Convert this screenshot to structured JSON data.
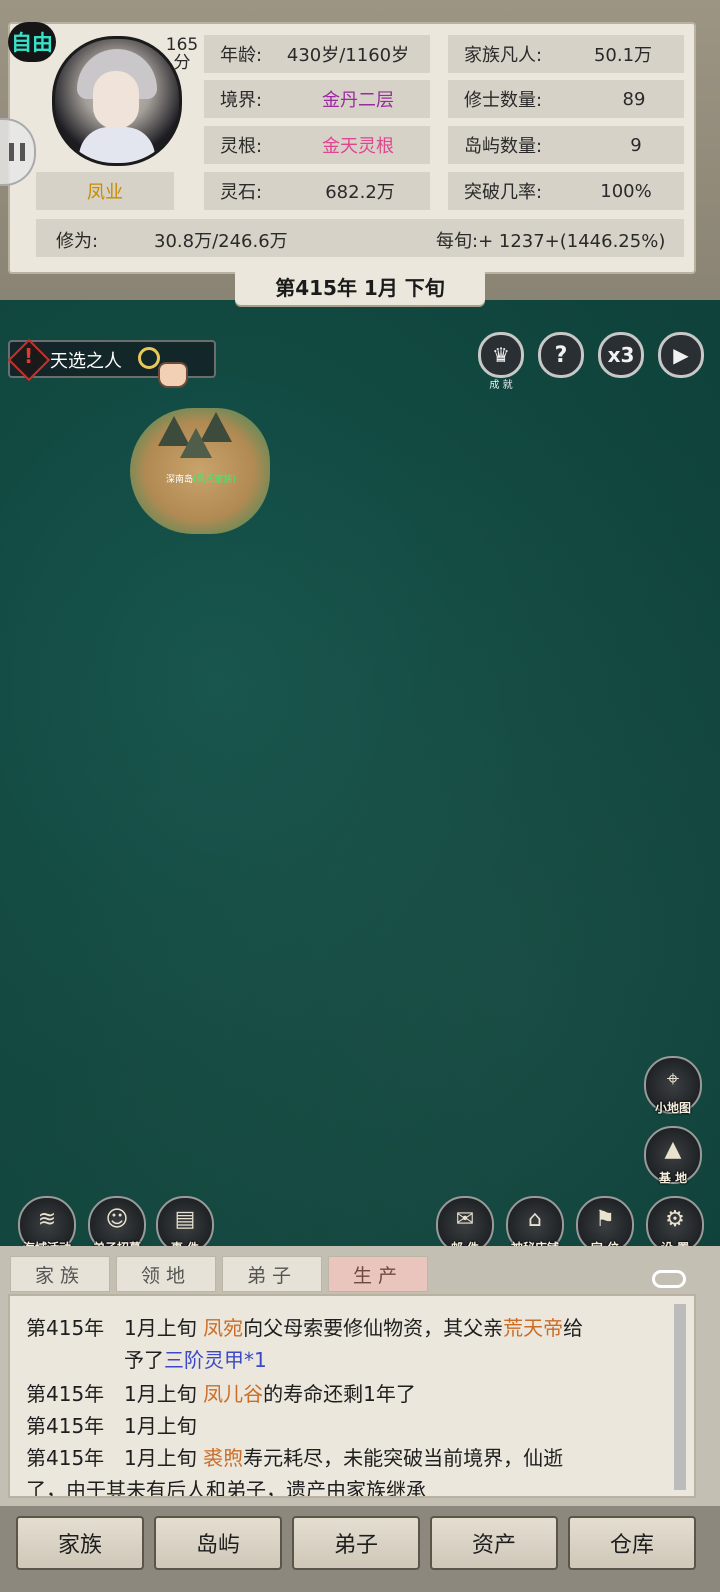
{
  "header": {
    "mode_badge": "自由",
    "score_value": "165",
    "score_unit": "分",
    "character_name": "凤业",
    "stats_left": [
      {
        "label": "年龄:",
        "value": "430岁/1160岁",
        "color": "#2a2a2a"
      },
      {
        "label": "境界:",
        "value": "金丹二层",
        "color": "#9a2aa0"
      },
      {
        "label": "灵根:",
        "value": "金天灵根",
        "color": "#e0458f"
      },
      {
        "label": "灵石:",
        "value": "682.2万",
        "color": "#2a2a2a"
      }
    ],
    "stats_right": [
      {
        "label": "家族凡人:",
        "value": "50.1万"
      },
      {
        "label": "修士数量:",
        "value": "89"
      },
      {
        "label": "岛屿数量:",
        "value": "9"
      },
      {
        "label": "突破几率:",
        "value": "100%"
      }
    ],
    "cultivation_label": "修为:",
    "cultivation_value": "30.8万/246.6万",
    "per_period": "每旬:+ 1237+(1446.25%)"
  },
  "date_banner": "第415年 1月 下旬",
  "event_tag": "天选之人",
  "top_buttons": {
    "achievements_caption": "成 就",
    "help_glyph": "?",
    "speed_label": "x3",
    "play_glyph": "▶"
  },
  "map": {
    "island_name": "深南岛",
    "island_owner": "(凤氏家族)"
  },
  "right_icons": [
    {
      "caption": "小地图",
      "glyph": "⌖"
    },
    {
      "caption": "基 地",
      "glyph": "▲"
    }
  ],
  "bottom_left_icons": [
    {
      "caption": "海域活动",
      "glyph": "≋"
    },
    {
      "caption": "弟子招募",
      "glyph": "☺"
    },
    {
      "caption": "事 件",
      "glyph": "▤"
    }
  ],
  "bottom_right_icons": [
    {
      "caption": "邮 件",
      "glyph": "✉"
    },
    {
      "caption": "神秘店铺",
      "glyph": "⌂"
    },
    {
      "caption": "定 位",
      "glyph": "⚑"
    },
    {
      "caption": "设 置",
      "glyph": "⚙"
    }
  ],
  "log_tabs": [
    "家族",
    "领地",
    "弟子",
    "生产"
  ],
  "log": {
    "l1_year": "第415年",
    "l1_a": "1月上旬 ",
    "l1_name": "凤宛",
    "l1_b": "向父母索要修仙物资，其父亲",
    "l1_father": "荒天帝",
    "l1_c": "给",
    "l1_d": "予了",
    "l1_item": "三阶灵甲*1",
    "l2_year": "第415年",
    "l2_a": "1月上旬 ",
    "l2_name": "凤儿谷",
    "l2_b": "的寿命还剩1年了",
    "l3_year": "第415年",
    "l3_a": "1月上旬",
    "l4_year": "第415年",
    "l4_a": "1月上旬 ",
    "l4_name": "裘煦",
    "l4_b": "寿元耗尽，未能突破当前境界，仙逝",
    "l4_c": "了，由于其未有后人和弟子，遗产由家族继承"
  },
  "bottom_nav": [
    "家族",
    "岛屿",
    "弟子",
    "资产",
    "仓库"
  ]
}
